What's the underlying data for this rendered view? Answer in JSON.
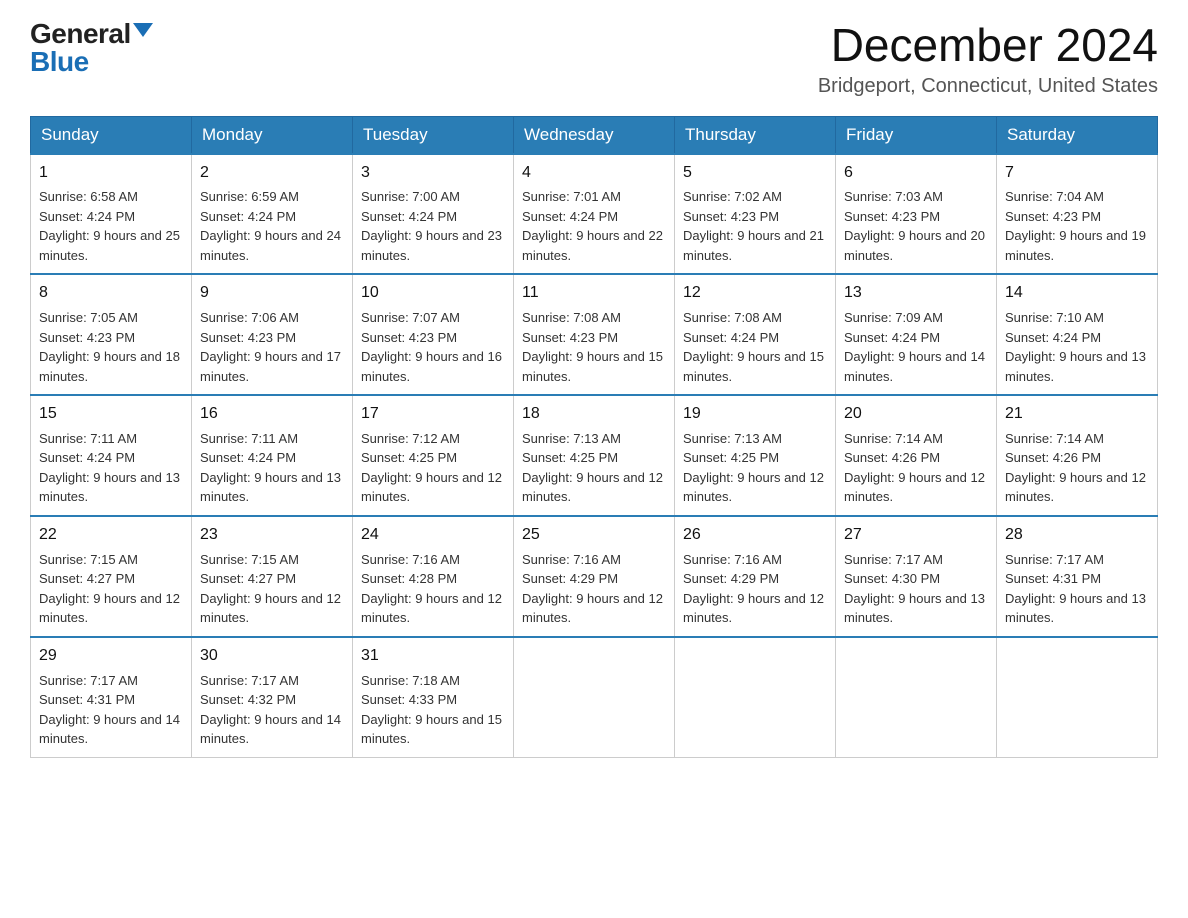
{
  "header": {
    "logo_general": "General",
    "logo_blue": "Blue",
    "month_year": "December 2024",
    "location": "Bridgeport, Connecticut, United States"
  },
  "days_of_week": [
    "Sunday",
    "Monday",
    "Tuesday",
    "Wednesday",
    "Thursday",
    "Friday",
    "Saturday"
  ],
  "weeks": [
    [
      {
        "day": 1,
        "sunrise": "6:58 AM",
        "sunset": "4:24 PM",
        "daylight": "9 hours and 25 minutes."
      },
      {
        "day": 2,
        "sunrise": "6:59 AM",
        "sunset": "4:24 PM",
        "daylight": "9 hours and 24 minutes."
      },
      {
        "day": 3,
        "sunrise": "7:00 AM",
        "sunset": "4:24 PM",
        "daylight": "9 hours and 23 minutes."
      },
      {
        "day": 4,
        "sunrise": "7:01 AM",
        "sunset": "4:24 PM",
        "daylight": "9 hours and 22 minutes."
      },
      {
        "day": 5,
        "sunrise": "7:02 AM",
        "sunset": "4:23 PM",
        "daylight": "9 hours and 21 minutes."
      },
      {
        "day": 6,
        "sunrise": "7:03 AM",
        "sunset": "4:23 PM",
        "daylight": "9 hours and 20 minutes."
      },
      {
        "day": 7,
        "sunrise": "7:04 AM",
        "sunset": "4:23 PM",
        "daylight": "9 hours and 19 minutes."
      }
    ],
    [
      {
        "day": 8,
        "sunrise": "7:05 AM",
        "sunset": "4:23 PM",
        "daylight": "9 hours and 18 minutes."
      },
      {
        "day": 9,
        "sunrise": "7:06 AM",
        "sunset": "4:23 PM",
        "daylight": "9 hours and 17 minutes."
      },
      {
        "day": 10,
        "sunrise": "7:07 AM",
        "sunset": "4:23 PM",
        "daylight": "9 hours and 16 minutes."
      },
      {
        "day": 11,
        "sunrise": "7:08 AM",
        "sunset": "4:23 PM",
        "daylight": "9 hours and 15 minutes."
      },
      {
        "day": 12,
        "sunrise": "7:08 AM",
        "sunset": "4:24 PM",
        "daylight": "9 hours and 15 minutes."
      },
      {
        "day": 13,
        "sunrise": "7:09 AM",
        "sunset": "4:24 PM",
        "daylight": "9 hours and 14 minutes."
      },
      {
        "day": 14,
        "sunrise": "7:10 AM",
        "sunset": "4:24 PM",
        "daylight": "9 hours and 13 minutes."
      }
    ],
    [
      {
        "day": 15,
        "sunrise": "7:11 AM",
        "sunset": "4:24 PM",
        "daylight": "9 hours and 13 minutes."
      },
      {
        "day": 16,
        "sunrise": "7:11 AM",
        "sunset": "4:24 PM",
        "daylight": "9 hours and 13 minutes."
      },
      {
        "day": 17,
        "sunrise": "7:12 AM",
        "sunset": "4:25 PM",
        "daylight": "9 hours and 12 minutes."
      },
      {
        "day": 18,
        "sunrise": "7:13 AM",
        "sunset": "4:25 PM",
        "daylight": "9 hours and 12 minutes."
      },
      {
        "day": 19,
        "sunrise": "7:13 AM",
        "sunset": "4:25 PM",
        "daylight": "9 hours and 12 minutes."
      },
      {
        "day": 20,
        "sunrise": "7:14 AM",
        "sunset": "4:26 PM",
        "daylight": "9 hours and 12 minutes."
      },
      {
        "day": 21,
        "sunrise": "7:14 AM",
        "sunset": "4:26 PM",
        "daylight": "9 hours and 12 minutes."
      }
    ],
    [
      {
        "day": 22,
        "sunrise": "7:15 AM",
        "sunset": "4:27 PM",
        "daylight": "9 hours and 12 minutes."
      },
      {
        "day": 23,
        "sunrise": "7:15 AM",
        "sunset": "4:27 PM",
        "daylight": "9 hours and 12 minutes."
      },
      {
        "day": 24,
        "sunrise": "7:16 AM",
        "sunset": "4:28 PM",
        "daylight": "9 hours and 12 minutes."
      },
      {
        "day": 25,
        "sunrise": "7:16 AM",
        "sunset": "4:29 PM",
        "daylight": "9 hours and 12 minutes."
      },
      {
        "day": 26,
        "sunrise": "7:16 AM",
        "sunset": "4:29 PM",
        "daylight": "9 hours and 12 minutes."
      },
      {
        "day": 27,
        "sunrise": "7:17 AM",
        "sunset": "4:30 PM",
        "daylight": "9 hours and 13 minutes."
      },
      {
        "day": 28,
        "sunrise": "7:17 AM",
        "sunset": "4:31 PM",
        "daylight": "9 hours and 13 minutes."
      }
    ],
    [
      {
        "day": 29,
        "sunrise": "7:17 AM",
        "sunset": "4:31 PM",
        "daylight": "9 hours and 14 minutes."
      },
      {
        "day": 30,
        "sunrise": "7:17 AM",
        "sunset": "4:32 PM",
        "daylight": "9 hours and 14 minutes."
      },
      {
        "day": 31,
        "sunrise": "7:18 AM",
        "sunset": "4:33 PM",
        "daylight": "9 hours and 15 minutes."
      },
      null,
      null,
      null,
      null
    ]
  ]
}
